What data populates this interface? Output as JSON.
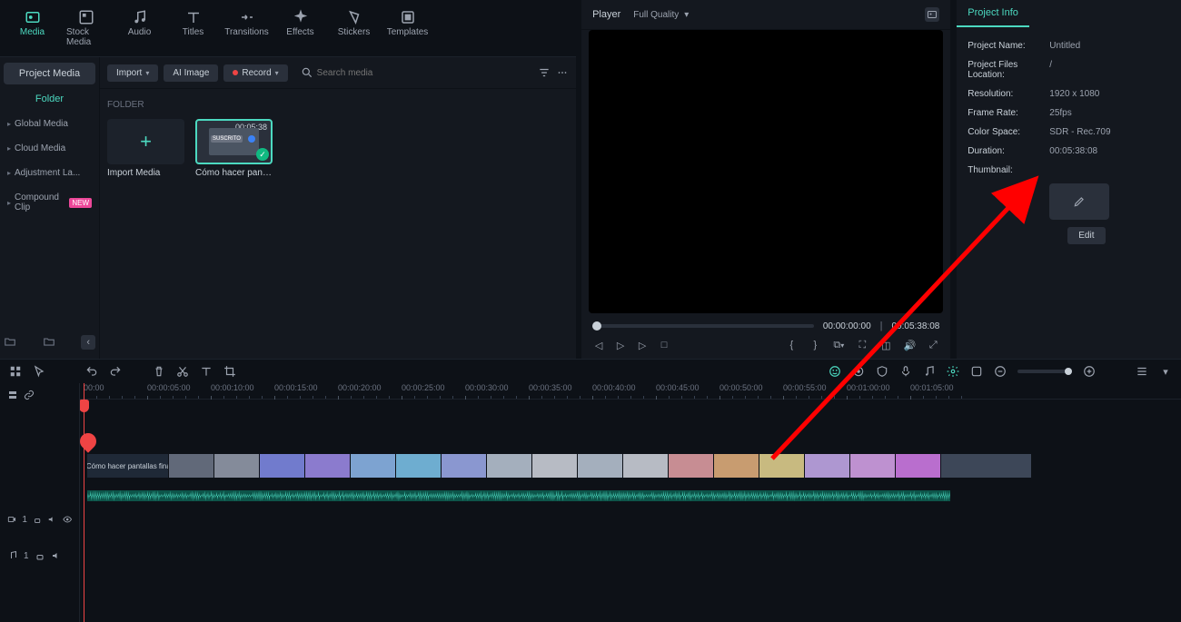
{
  "nav_tabs": [
    {
      "label": "Media",
      "icon": "media"
    },
    {
      "label": "Stock Media",
      "icon": "stock"
    },
    {
      "label": "Audio",
      "icon": "audio"
    },
    {
      "label": "Titles",
      "icon": "titles"
    },
    {
      "label": "Transitions",
      "icon": "transitions"
    },
    {
      "label": "Effects",
      "icon": "effects"
    },
    {
      "label": "Stickers",
      "icon": "stickers"
    },
    {
      "label": "Templates",
      "icon": "templates"
    }
  ],
  "sidebar": {
    "project_media": "Project Media",
    "folder": "Folder",
    "items": [
      {
        "label": "Global Media"
      },
      {
        "label": "Cloud Media"
      },
      {
        "label": "Adjustment La..."
      },
      {
        "label": "Compound Clip",
        "badge": "NEW"
      }
    ]
  },
  "media_toolbar": {
    "import": "Import",
    "ai_image": "AI Image",
    "record": "Record",
    "search_placeholder": "Search media"
  },
  "media_content": {
    "folder_label": "FOLDER",
    "import_label": "Import Media",
    "clip": {
      "duration": "00:05:38",
      "name": "Cómo hacer pantallas ...",
      "badge": "SUSCRITO"
    }
  },
  "player": {
    "label": "Player",
    "quality": "Full Quality",
    "time_current": "00:00:00:00",
    "time_total": "00:05:38:08"
  },
  "project_info": {
    "title": "Project Info",
    "rows": [
      {
        "key": "Project Name:",
        "val": "Untitled"
      },
      {
        "key": "Project Files Location:",
        "val": "/"
      },
      {
        "key": "Resolution:",
        "val": "1920 x 1080"
      },
      {
        "key": "Frame Rate:",
        "val": "25fps"
      },
      {
        "key": "Color Space:",
        "val": "SDR - Rec.709"
      },
      {
        "key": "Duration:",
        "val": "00:05:38:08"
      },
      {
        "key": "Thumbnail:",
        "val": ""
      }
    ],
    "edit": "Edit"
  },
  "timeline": {
    "ruler": [
      "00:00",
      "00:00:05:00",
      "00:00:10:00",
      "00:00:15:00",
      "00:00:20:00",
      "00:00:25:00",
      "00:00:30:00",
      "00:00:35:00",
      "00:00:40:00",
      "00:00:45:00",
      "00:00:50:00",
      "00:00:55:00",
      "00:01:00:00",
      "00:01:05:00"
    ],
    "video_track": "1",
    "audio_track": "1",
    "clip_name": "Cómo hacer pantallas fina..."
  }
}
